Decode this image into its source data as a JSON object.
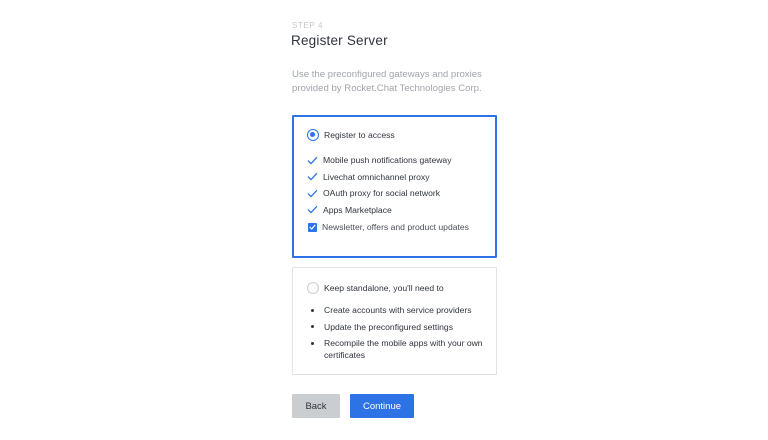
{
  "header": {
    "step": "STEP 4",
    "title": "Register Server",
    "description": "Use the preconfigured gateways and proxies provided by Rocket.Chat Technologies Corp."
  },
  "register_option": {
    "label": "Register to access",
    "selected": true,
    "features": [
      "Mobile push notifications gateway",
      "Livechat omnichannel proxy",
      "OAuth proxy for social network",
      "Apps Marketplace"
    ],
    "newsletter": {
      "label": "Newsletter, offers and product updates",
      "checked": true
    }
  },
  "standalone_option": {
    "label": "Keep standalone, you'll need to",
    "selected": false,
    "items": [
      "Create accounts with service providers",
      "Update the preconfigured settings",
      "Recompile the mobile apps with your own certificates"
    ]
  },
  "actions": {
    "back_label": "Back",
    "continue_label": "Continue"
  },
  "colors": {
    "accent": "#2d73e6",
    "back_button": "#cbced1"
  }
}
